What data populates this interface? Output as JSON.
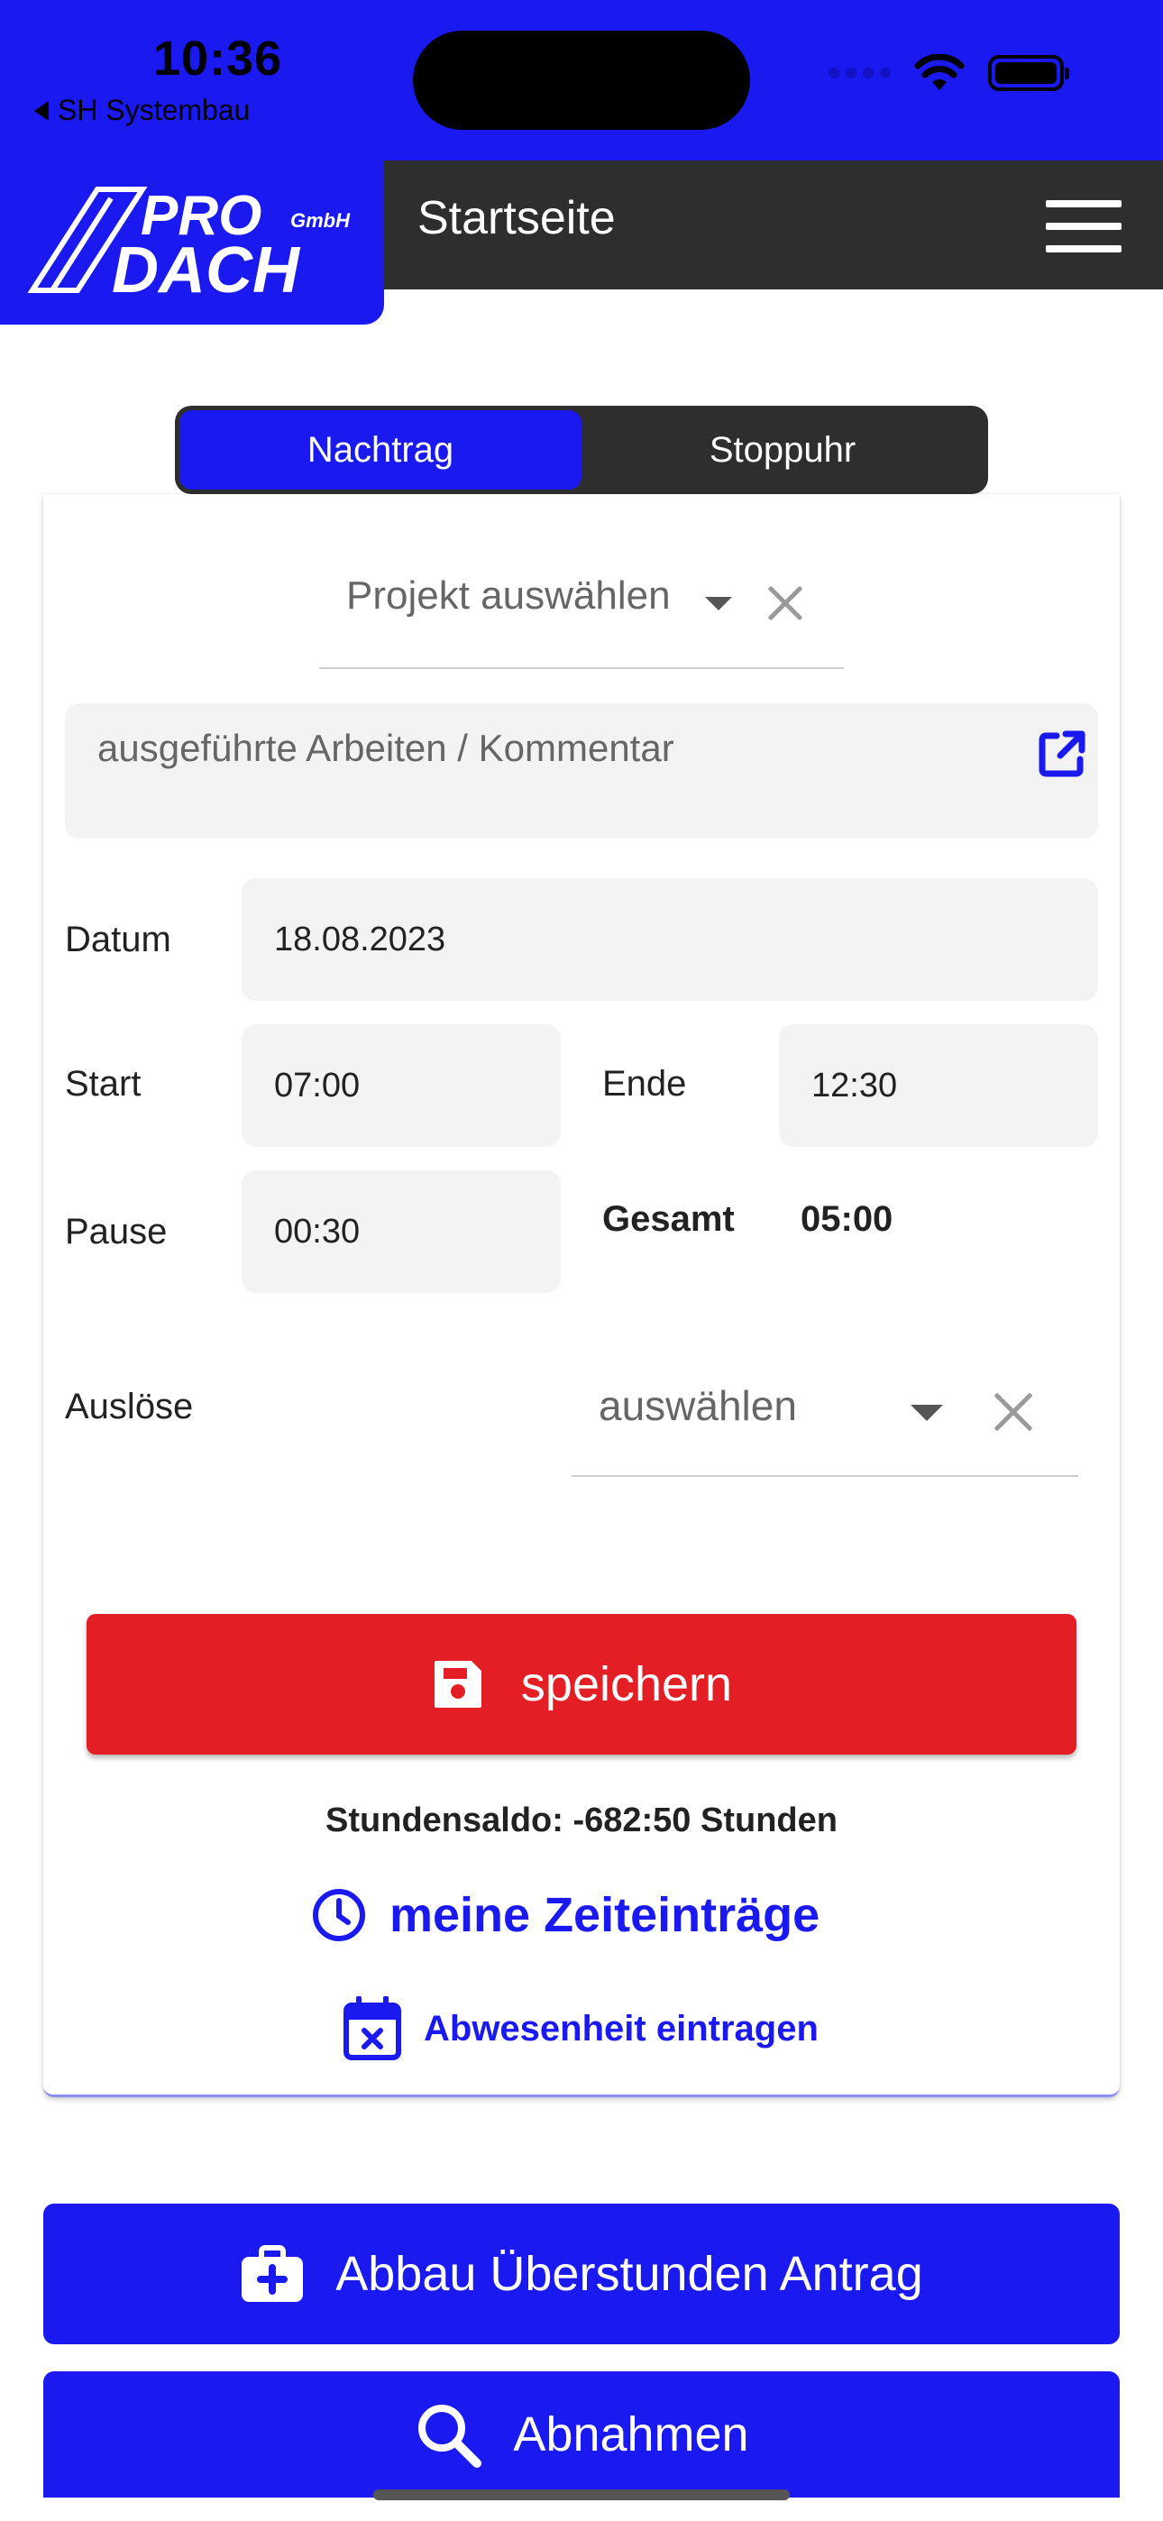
{
  "status_bar": {
    "time": "10:36",
    "back_app": "SH Systembau",
    "battery_icon": "battery-full-icon",
    "wifi_icon": "wifi-icon"
  },
  "header": {
    "logo_line1": "PRO",
    "logo_line2": "DACH",
    "logo_suffix": "GmbH",
    "title": "Startseite",
    "menu_icon": "hamburger-menu-icon"
  },
  "tabs": [
    {
      "label": "Nachtrag",
      "active": true
    },
    {
      "label": "Stoppuhr",
      "active": false
    }
  ],
  "form": {
    "project_placeholder": "Projekt auswählen",
    "comment_placeholder": "ausgeführte Arbeiten / Kommentar",
    "datum_label": "Datum",
    "datum_value": "18.08.2023",
    "start_label": "Start",
    "start_value": "07:00",
    "ende_label": "Ende",
    "ende_value": "12:30",
    "pause_label": "Pause",
    "pause_value": "00:30",
    "gesamt_label": "Gesamt",
    "gesamt_value": "05:00",
    "ausloese_label": "Auslöse",
    "ausloese_placeholder": "auswählen",
    "save_label": "speichern"
  },
  "summary": {
    "saldo": "Stundensaldo: -682:50 Stunden",
    "zeit_link": "meine Zeiteinträge",
    "abwesenheit_link": "Abwesenheit eintragen"
  },
  "actions": {
    "ueberstunden_label": "Abbau Überstunden Antrag",
    "abnahmen_label": "Abnahmen"
  },
  "colors": {
    "brand_blue": "#1919f0",
    "dark_bar": "#2e2e2e",
    "save_red": "#e31e24",
    "field_bg": "#f3f3f3"
  }
}
